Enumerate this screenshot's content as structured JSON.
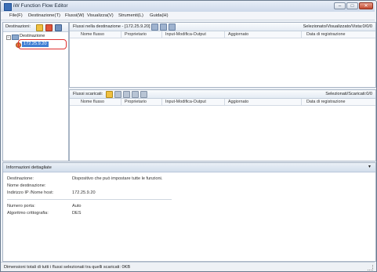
{
  "window": {
    "title": "iW Function Flow Editor",
    "minimize_label": "–",
    "maximize_label": "□",
    "close_label": "✕"
  },
  "menu": [
    "File(F)",
    "Destinazione(T)",
    "Flussi(W)",
    "Visualizza(V)",
    "Strumenti(L)",
    "Guida(H)"
  ],
  "left_pane": {
    "label": "Destinazioni:",
    "tree_root": "Destinazione",
    "tree_expander": "−",
    "tree_child": "172.25.9.20"
  },
  "dest_flows": {
    "label": "Flussi nella destinazione - [172.25.9.20] :",
    "counter": "Selezionato/Visualizzato/Vista:0/0/0",
    "columns": [
      "Nome flusso",
      "Proprietario",
      "Input-Modifica-Output",
      "Aggiornato",
      "Data di registrazione"
    ]
  },
  "downloaded_flows": {
    "label": "Flussi scaricati:",
    "counter": "Selezionati/Scaricati:0/0",
    "columns": [
      "Nome flusso",
      "Proprietario",
      "Input-Modifica-Output",
      "Aggiornato",
      "Data di registrazione"
    ]
  },
  "details": {
    "title": "Informazioni dettagliate",
    "collapse_glyph": "▾",
    "rows": [
      {
        "label": "Destinazione:",
        "value": "Dispositivo che può impostare tutte le funzioni."
      },
      {
        "label": "Nome destinazione:",
        "value": ""
      },
      {
        "label": "Indirizzo IP /Nome host:",
        "value": "172.25.9.20"
      },
      {
        "label": "Numero porta:",
        "value": "Auto"
      },
      {
        "label": "Algoritmo crittografia:",
        "value": "DES"
      }
    ]
  },
  "status": {
    "text": "Dimensioni totali di tutti i flussi selezionati tra quelli scaricati: 0KB"
  },
  "colors": {
    "selection": "#3f7fd4",
    "highlight_ring": "#e03030"
  },
  "icons": {
    "toolbar_left": [
      "new-destination-icon",
      "delete-destination-icon",
      "destination-settings-icon"
    ],
    "toolbar_dest": [
      "search-icon",
      "transfer-icon",
      "flow-icon"
    ],
    "toolbar_downloaded": [
      "folder-icon",
      "edit-icon",
      "copy-icon",
      "download-icon",
      "lock-icon"
    ]
  }
}
